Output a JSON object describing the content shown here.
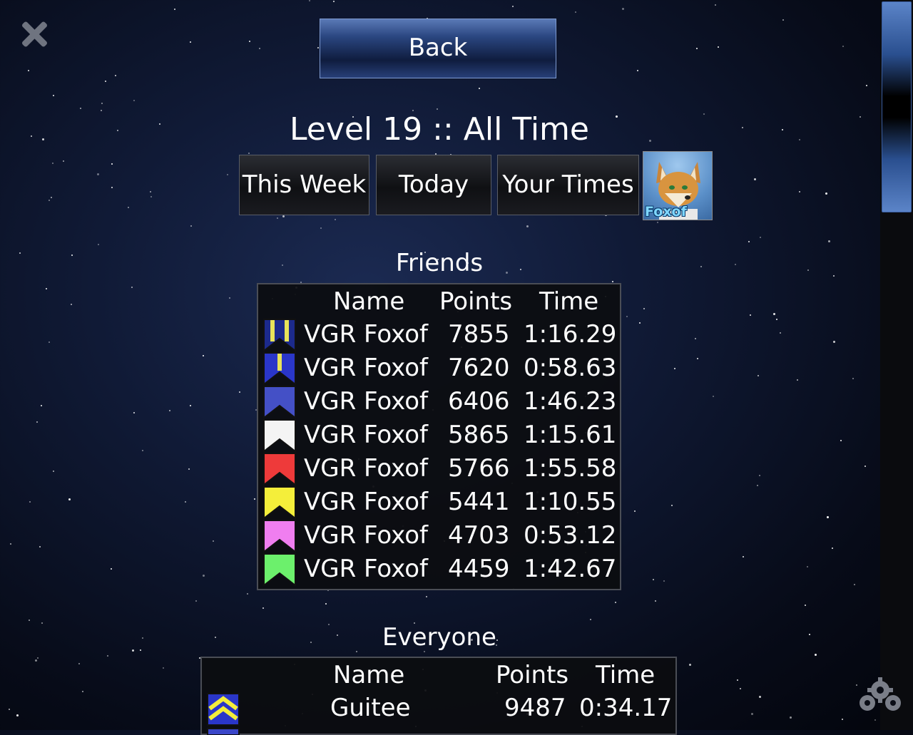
{
  "nav": {
    "back_label": "Back"
  },
  "title": "Level 19 :: All Time",
  "tabs": [
    {
      "label": "This Week"
    },
    {
      "label": "Today"
    },
    {
      "label": "Your Times"
    }
  ],
  "avatar": {
    "name": "Foxof"
  },
  "friends": {
    "title": "Friends",
    "headers": {
      "name": "Name",
      "points": "Points",
      "time": "Time"
    },
    "rows": [
      {
        "name": "VGR Foxof",
        "points": "7855",
        "time": "1:16.29",
        "badge": "navy-gold-stripes"
      },
      {
        "name": "VGR Foxof",
        "points": "7620",
        "time": "0:58.63",
        "badge": "blue-gold-stripe"
      },
      {
        "name": "VGR Foxof",
        "points": "6406",
        "time": "1:46.23",
        "badge": "blue"
      },
      {
        "name": "VGR Foxof",
        "points": "5865",
        "time": "1:15.61",
        "badge": "white"
      },
      {
        "name": "VGR Foxof",
        "points": "5766",
        "time": "1:55.58",
        "badge": "red"
      },
      {
        "name": "VGR Foxof",
        "points": "5441",
        "time": "1:10.55",
        "badge": "yellow"
      },
      {
        "name": "VGR Foxof",
        "points": "4703",
        "time": "0:53.12",
        "badge": "pink"
      },
      {
        "name": "VGR Foxof",
        "points": "4459",
        "time": "1:42.67",
        "badge": "green"
      }
    ]
  },
  "everyone": {
    "title": "Everyone",
    "headers": {
      "name": "Name",
      "points": "Points",
      "time": "Time"
    },
    "rows": [
      {
        "name": "Guitee",
        "points": "9487",
        "time": "0:34.17",
        "badge": "yellow-chevron"
      }
    ]
  },
  "colors": {
    "button_blue": "#2a4680",
    "panel_bg": "#0c0d10",
    "scroll_thumb": "#5b84c8"
  },
  "icons": {
    "close": "close-icon",
    "settings": "gears-icon"
  }
}
